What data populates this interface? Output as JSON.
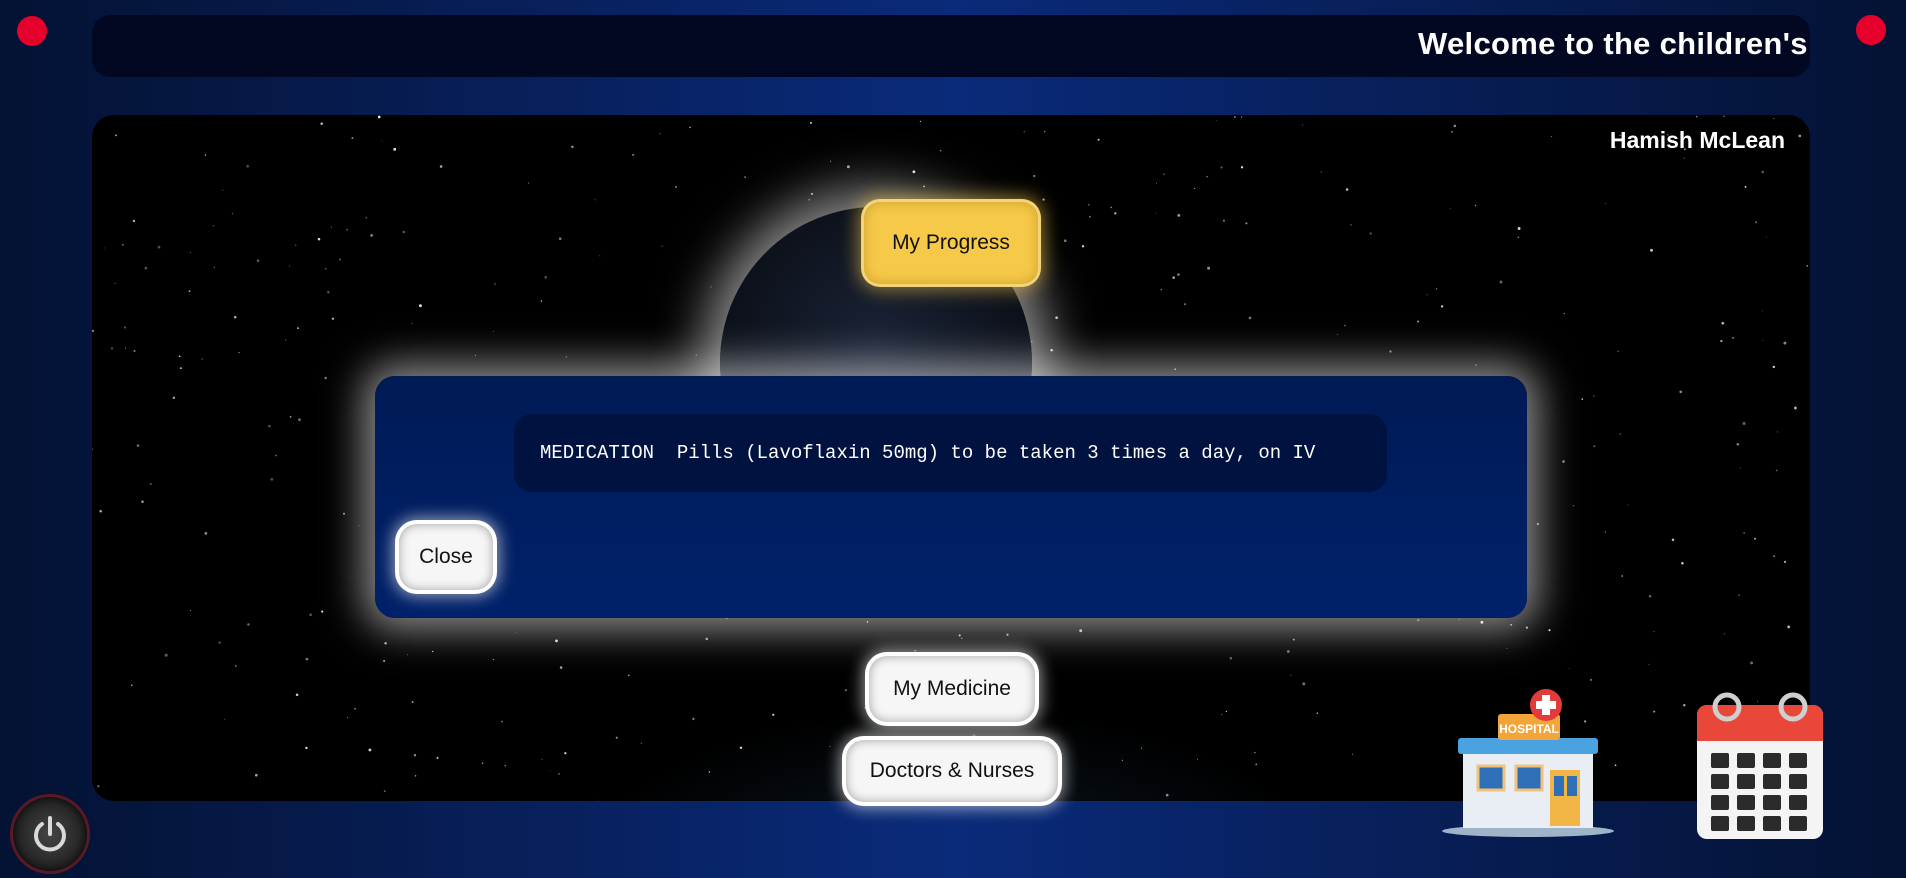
{
  "marquee": {
    "text": "Welcome to the children's p"
  },
  "user": {
    "name": "Hamish McLean"
  },
  "menu": {
    "progress_label": "My Progress",
    "medicine_label": "My Medicine",
    "doctors_label": "Doctors & Nurses"
  },
  "modal": {
    "medication_text": "MEDICATION  Pills (Lavoflaxin 50mg) to be taken 3 times a day, on IV",
    "close_label": "Close"
  },
  "hospital_icon": {
    "sign": "HOSPITAL"
  },
  "icons": [
    "power-icon",
    "hospital-icon",
    "calendar-icon"
  ],
  "colors": {
    "accent_yellow": "#f7c948",
    "indicator_red": "#e8002d",
    "modal_blue": "#001a55"
  }
}
